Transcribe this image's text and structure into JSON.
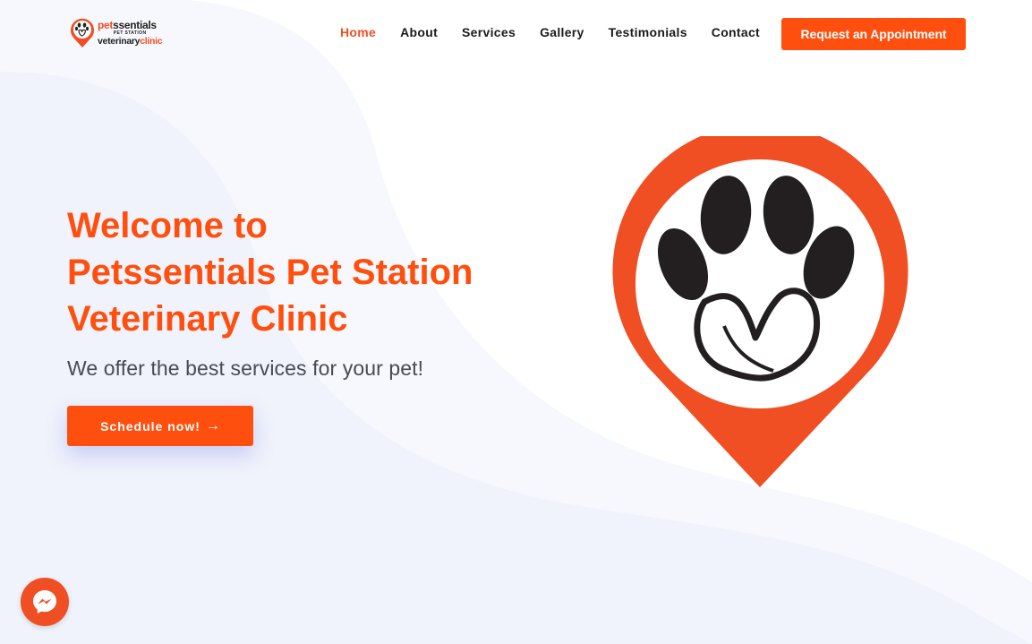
{
  "logo": {
    "line1_pet": "pet",
    "line1_rest": "ssentials",
    "line2": "PET STATION",
    "line3_veterinary": "veterinary",
    "line3_clinic": "clinic"
  },
  "nav": {
    "items": [
      {
        "label": "Home",
        "active": true
      },
      {
        "label": "About"
      },
      {
        "label": "Services"
      },
      {
        "label": "Gallery"
      },
      {
        "label": "Testimonials"
      },
      {
        "label": "Contact"
      }
    ],
    "cta_label": "Request an Appointment"
  },
  "hero": {
    "title_line1": "Welcome to",
    "title_line2": "Petssentials Pet Station",
    "title_line3": "Veterinary Clinic",
    "subtitle": "We offer the best services for your pet!",
    "button_label": "Schedule now!",
    "button_arrow": "→"
  },
  "icons": {
    "hero_graphic": "paw-heart-map-pin-icon",
    "chat": "messenger-icon"
  },
  "colors": {
    "accent": "#ff4f0f",
    "pin": "#f04e23",
    "text": "#1a1a1a",
    "subtitle": "#4a4a54",
    "background_wave": "#eef1fb"
  }
}
